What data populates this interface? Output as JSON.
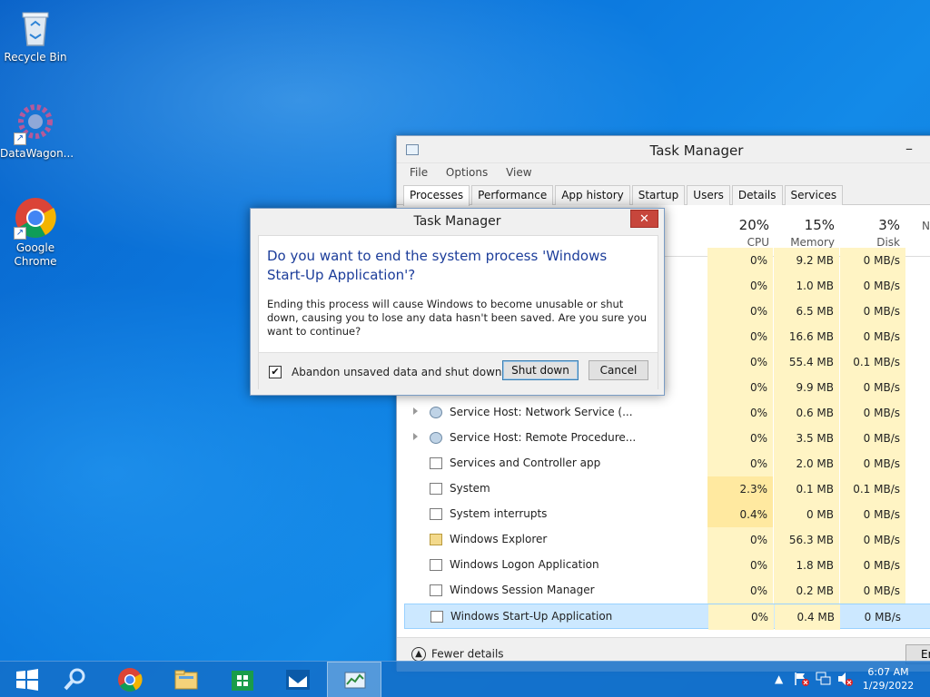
{
  "desktop": {
    "icons": [
      {
        "label": "Recycle Bin"
      },
      {
        "label": "DataWagon..."
      },
      {
        "label": "Google Chrome"
      }
    ]
  },
  "task_manager": {
    "title": "Task Manager",
    "minimize_glyph": "–",
    "menu": [
      "File",
      "Options",
      "View"
    ],
    "tabs": [
      "Processes",
      "Performance",
      "App history",
      "Startup",
      "Users",
      "Details",
      "Services"
    ],
    "columns": [
      {
        "pct": "20%",
        "label": "CPU"
      },
      {
        "pct": "15%",
        "label": "Memory"
      },
      {
        "pct": "3%",
        "label": "Disk"
      },
      {
        "pct": "",
        "label": "N"
      }
    ],
    "rows": [
      {
        "name": "",
        "cpu": "0%",
        "mem": "9.2 MB",
        "disk": "0 MB/s",
        "icon": "window",
        "expand": false
      },
      {
        "name": "",
        "cpu": "0%",
        "mem": "1.0 MB",
        "disk": "0 MB/s",
        "icon": "window",
        "expand": false
      },
      {
        "name": "",
        "cpu": "0%",
        "mem": "6.5 MB",
        "disk": "0 MB/s",
        "icon": "window",
        "expand": false
      },
      {
        "name": "",
        "cpu": "0%",
        "mem": "16.6 MB",
        "disk": "0 MB/s",
        "icon": "window",
        "expand": false
      },
      {
        "name": "",
        "cpu": "0%",
        "mem": "55.4 MB",
        "disk": "0.1 MB/s",
        "icon": "window",
        "expand": false
      },
      {
        "name": "",
        "cpu": "0%",
        "mem": "9.9 MB",
        "disk": "0 MB/s",
        "icon": "window",
        "expand": false
      },
      {
        "name": "Service Host: Network Service (...",
        "cpu": "0%",
        "mem": "0.6 MB",
        "disk": "0 MB/s",
        "icon": "gear",
        "expand": true
      },
      {
        "name": "Service Host: Remote Procedure...",
        "cpu": "0%",
        "mem": "3.5 MB",
        "disk": "0 MB/s",
        "icon": "gear",
        "expand": true
      },
      {
        "name": "Services and Controller app",
        "cpu": "0%",
        "mem": "2.0 MB",
        "disk": "0 MB/s",
        "icon": "window",
        "expand": false
      },
      {
        "name": "System",
        "cpu": "2.3%",
        "mem": "0.1 MB",
        "disk": "0.1 MB/s",
        "icon": "window",
        "expand": false
      },
      {
        "name": "System interrupts",
        "cpu": "0.4%",
        "mem": "0 MB",
        "disk": "0 MB/s",
        "icon": "window",
        "expand": false
      },
      {
        "name": "Windows Explorer",
        "cpu": "0%",
        "mem": "56.3 MB",
        "disk": "0 MB/s",
        "icon": "folder",
        "expand": false
      },
      {
        "name": "Windows Logon Application",
        "cpu": "0%",
        "mem": "1.8 MB",
        "disk": "0 MB/s",
        "icon": "window",
        "expand": false
      },
      {
        "name": "Windows Session Manager",
        "cpu": "0%",
        "mem": "0.2 MB",
        "disk": "0 MB/s",
        "icon": "window",
        "expand": false
      },
      {
        "name": "Windows Start-Up Application",
        "cpu": "0%",
        "mem": "0.4 MB",
        "disk": "0 MB/s",
        "icon": "window",
        "expand": false,
        "selected": true
      }
    ],
    "footer": {
      "fewer_details": "Fewer details",
      "end_task": "En"
    }
  },
  "dialog": {
    "title": "Task Manager",
    "close_glyph": "✕",
    "main_instruction": "Do you want to end the system process 'Windows Start-Up Application'?",
    "content": "Ending this process will cause Windows to become unusable or shut down, causing you to lose any data hasn't been saved. Are you sure you want to continue?",
    "checkbox_label": "Abandon unsaved data and shut down.",
    "checkbox_checked_glyph": "✔",
    "shutdown_label": "Shut down",
    "cancel_label": "Cancel"
  },
  "taskbar": {
    "clock_time": "6:07 AM",
    "clock_date": "1/29/2022"
  },
  "colors": {
    "accent": "#0b78de",
    "dialog_heading": "#1c3d9a",
    "selected_row": "#cce8ff",
    "cpu_cell": "#fff4c4"
  }
}
